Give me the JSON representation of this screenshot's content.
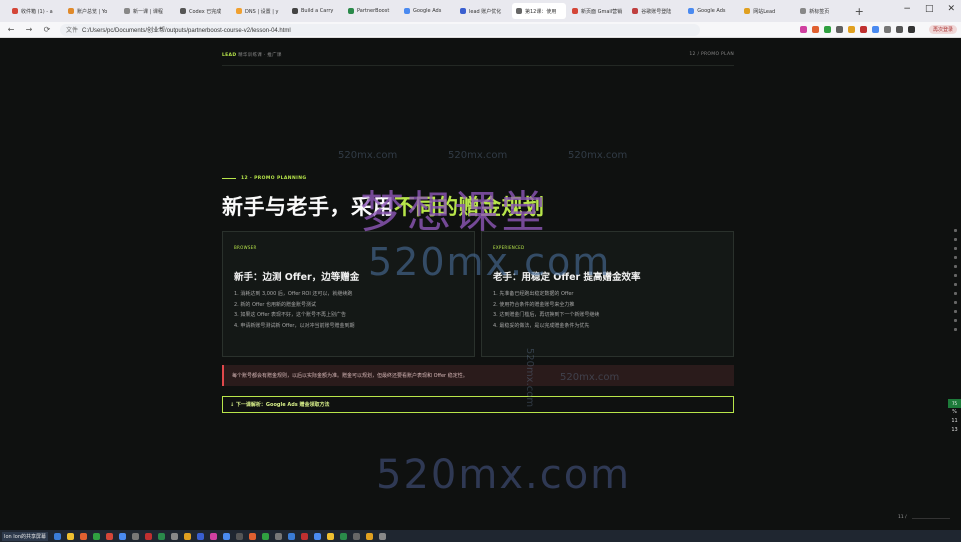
{
  "browser": {
    "tabs": [
      {
        "label": "收件箱 (1) - a",
        "color": "#d44638"
      },
      {
        "label": "账户总览 | Yo",
        "color": "#e08a2a"
      },
      {
        "label": "新一课 | 课程",
        "color": "#888888"
      },
      {
        "label": "Codex 已完成",
        "color": "#555555"
      },
      {
        "label": "DNS | 设置 | y",
        "color": "#f0a030"
      },
      {
        "label": "Build a Carry",
        "color": "#444444"
      },
      {
        "label": "PartnerBoost",
        "color": "#2a8a4a"
      },
      {
        "label": "Google Ads",
        "color": "#4a8af0"
      },
      {
        "label": "lead 账户优化",
        "color": "#3a5fd0"
      },
      {
        "label": "第12课：使用",
        "color": "#666666",
        "active": true
      },
      {
        "label": "新页面 Gmail营销",
        "color": "#d44638"
      },
      {
        "label": "谷歌账号登陆",
        "color": "#c04040"
      },
      {
        "label": "Google Ads",
        "color": "#4a8af0"
      },
      {
        "label": "网站Lead",
        "color": "#e0a020"
      },
      {
        "label": "新标签页",
        "color": "#888888"
      }
    ],
    "new_tab": "+",
    "window_controls": [
      "−",
      "□",
      "✕"
    ],
    "nav": {
      "back": "←",
      "forward": "→",
      "reload": "⟳"
    },
    "url_prefix": "文件",
    "url": "C:/Users/pc/Documents/创业帮/outputs/partnerboost-course-v2/lesson-04.html",
    "profile_label": "再次登录",
    "ext_colors": [
      "#d040a0",
      "#e06030",
      "#30a040",
      "#606060",
      "#e0a020",
      "#c03030",
      "#4a8af0",
      "#777777",
      "#555555",
      "#333333"
    ]
  },
  "page": {
    "brand_strong": "LEAD",
    "brand_rest": " 精华训练课 · 推广课",
    "top_right": "12 / PROMO PLAN",
    "kicker": "12 · PROMO PLANNING",
    "headline_a": "新手与老手，采用",
    "headline_b": "不同的赠金规划",
    "cards": [
      {
        "tag": "BROWSER",
        "title": "新手：边测 Offer，边等赠金",
        "items": [
          "1. 消耗达到 3,000 后，Offer ROI 还可以，就继续跑",
          "2. 新的 Offer 也用新的赠金账号测试",
          "3. 如果这 Offer 表现不好，这个账号不再上别广告",
          "4. 申请新账号测试新 Offer，以对冲当前账号赠金到期"
        ]
      },
      {
        "tag": "EXPERIENCED",
        "title": "老手：用稳定 Offer 提高赠金效率",
        "items": [
          "1. 先准备已经跑出稳定数据的 Offer",
          "2. 使用符合条件的赠金账号来全力推",
          "3. 达到赠金门槛后，再切换到下一个新账号继续",
          "4. 最稳妥的做法，是以完成赠金条件为优先"
        ]
      }
    ],
    "note": "每个账号都会有赠金规则，以后以实际金额为准。赠金可以规划，但最终还要看账户表现和 Offer 稳定性。",
    "next": "↓ 下一课解析：Google Ads 赠金领取方法",
    "page_num": "11 /"
  },
  "side_widget": {
    "badge": "75",
    "lines": [
      "%",
      "11",
      "13"
    ]
  },
  "watermark": {
    "cn": "梦想课堂",
    "big": "520mx.com",
    "small": [
      "520mx.com",
      "520mx.com",
      "520mx.com",
      "520mx.com",
      "520mx.com"
    ]
  },
  "taskbar": {
    "tip": "Ion Ion的共享屏幕",
    "icon_colors": [
      "#3a7bd5",
      "#f0c030",
      "#e06030",
      "#30a040",
      "#d44638",
      "#4a8af0",
      "#777777",
      "#c03030",
      "#2a8a4a",
      "#888888",
      "#e0a020",
      "#3a5fd0",
      "#d040a0",
      "#4a8af0",
      "#555555",
      "#e06030",
      "#30a040",
      "#777777",
      "#3a7bd5",
      "#c03030",
      "#4a8af0",
      "#f0c030",
      "#2a8a4a",
      "#666666",
      "#e0a020",
      "#888888"
    ]
  }
}
